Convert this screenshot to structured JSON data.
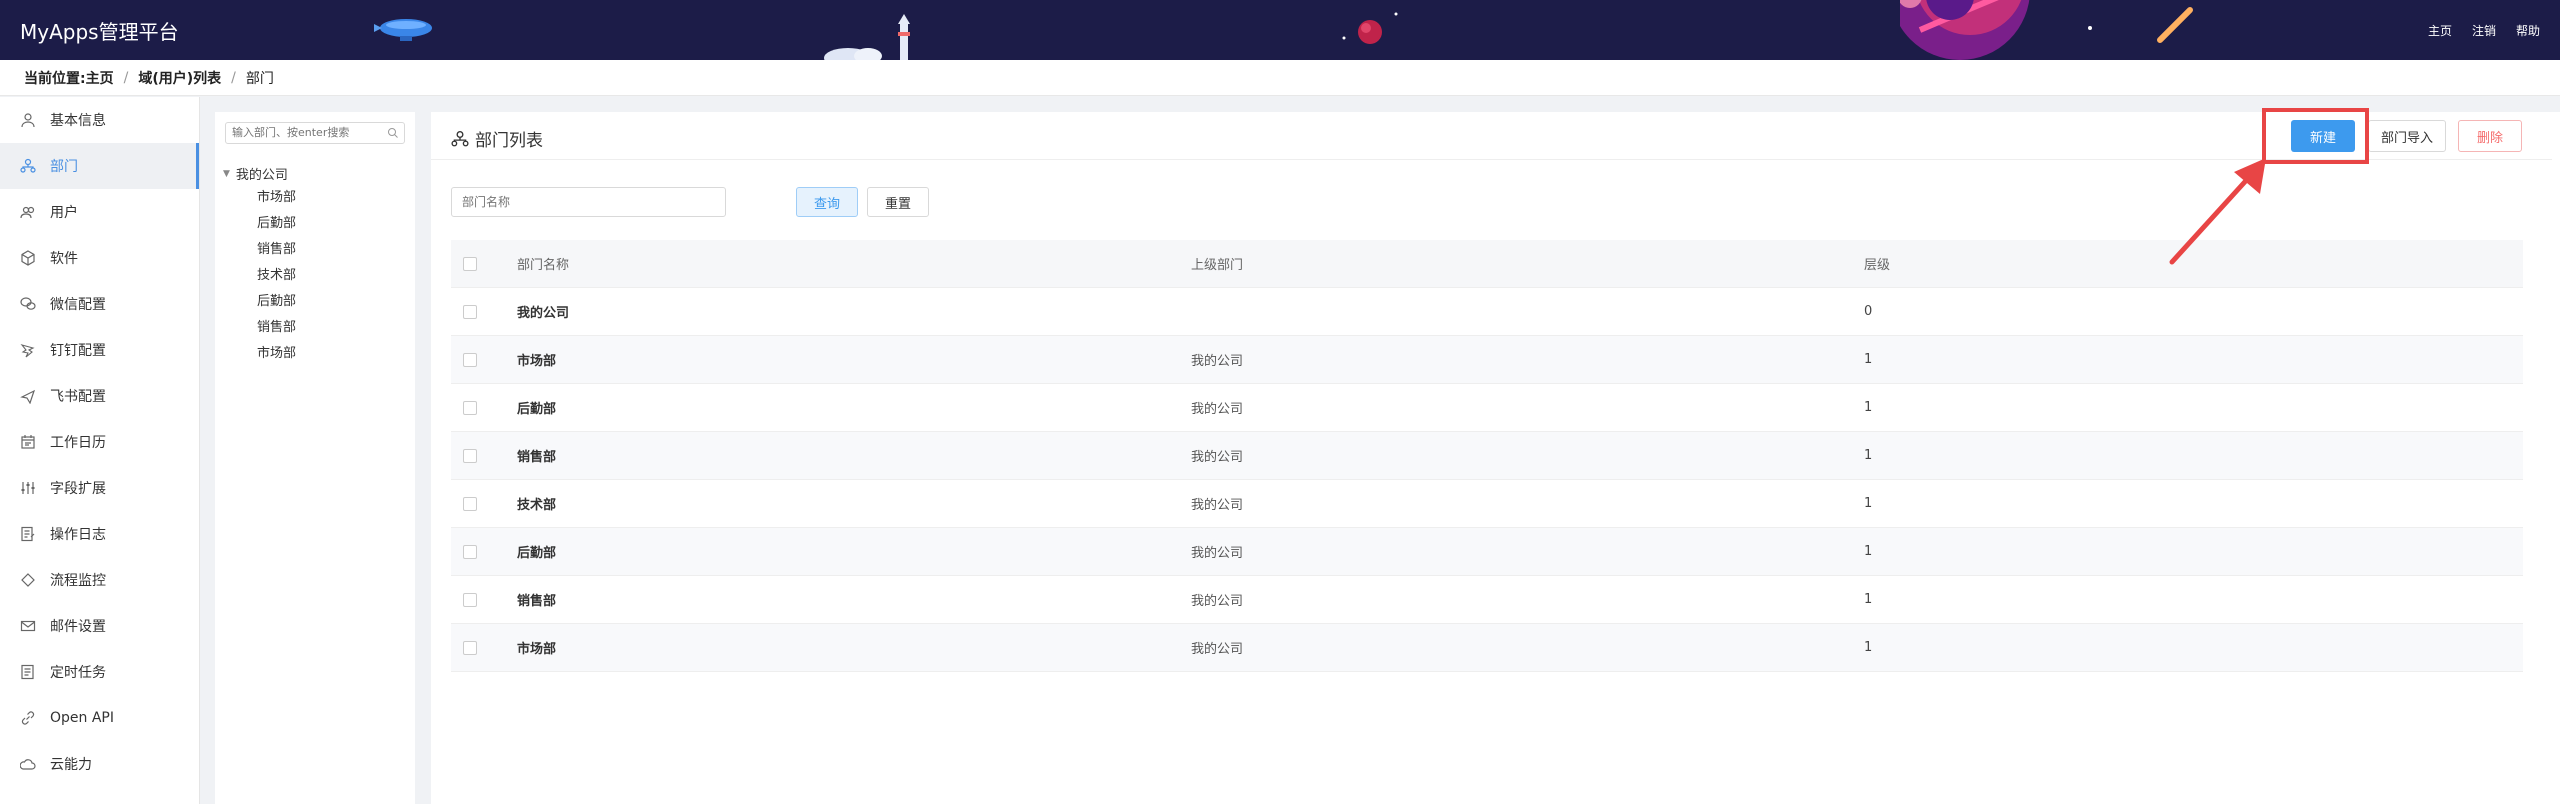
{
  "header": {
    "title": "MyApps管理平台",
    "links": [
      "主页",
      "注销",
      "帮助"
    ]
  },
  "breadcrumb": {
    "label": "当前位置:",
    "items": [
      "主页",
      "域(用户)列表",
      "部门"
    ]
  },
  "sidebar": {
    "items": [
      {
        "label": "基本信息",
        "icon": "user-icon",
        "active": false
      },
      {
        "label": "部门",
        "icon": "department-icon",
        "active": true
      },
      {
        "label": "用户",
        "icon": "users-icon",
        "active": false
      },
      {
        "label": "软件",
        "icon": "cube-icon",
        "active": false
      },
      {
        "label": "微信配置",
        "icon": "wechat-icon",
        "active": false
      },
      {
        "label": "钉钉配置",
        "icon": "dingtalk-icon",
        "active": false
      },
      {
        "label": "飞书配置",
        "icon": "feishu-icon",
        "active": false
      },
      {
        "label": "工作日历",
        "icon": "calendar-icon",
        "active": false
      },
      {
        "label": "字段扩展",
        "icon": "sliders-icon",
        "active": false
      },
      {
        "label": "操作日志",
        "icon": "log-icon",
        "active": false
      },
      {
        "label": "流程监控",
        "icon": "diamond-icon",
        "active": false
      },
      {
        "label": "邮件设置",
        "icon": "mail-icon",
        "active": false
      },
      {
        "label": "定时任务",
        "icon": "task-icon",
        "active": false
      },
      {
        "label": "Open API",
        "icon": "link-icon",
        "active": false
      },
      {
        "label": "云能力",
        "icon": "cloud-icon",
        "active": false
      }
    ]
  },
  "tree": {
    "search_placeholder": "输入部门、按enter搜索",
    "root": "我的公司",
    "children": [
      "市场部",
      "后勤部",
      "销售部",
      "技术部",
      "后勤部",
      "销售部",
      "市场部"
    ]
  },
  "main": {
    "title": "部门列表",
    "buttons": {
      "new": "新建",
      "import": "部门导入",
      "delete": "删除",
      "query": "查询",
      "reset": "重置"
    },
    "filter_placeholder": "部门名称",
    "columns": [
      "部门名称",
      "上级部门",
      "层级"
    ],
    "rows": [
      {
        "name": "我的公司",
        "parent": "",
        "level": "0"
      },
      {
        "name": "市场部",
        "parent": "我的公司",
        "level": "1"
      },
      {
        "name": "后勤部",
        "parent": "我的公司",
        "level": "1"
      },
      {
        "name": "销售部",
        "parent": "我的公司",
        "level": "1"
      },
      {
        "name": "技术部",
        "parent": "我的公司",
        "level": "1"
      },
      {
        "name": "后勤部",
        "parent": "我的公司",
        "level": "1"
      },
      {
        "name": "销售部",
        "parent": "我的公司",
        "level": "1"
      },
      {
        "name": "市场部",
        "parent": "我的公司",
        "level": "1"
      }
    ]
  },
  "colors": {
    "header_bg": "#1c1c48",
    "accent": "#3d9aee",
    "danger": "#f56c6c",
    "annotation": "#e84545"
  }
}
